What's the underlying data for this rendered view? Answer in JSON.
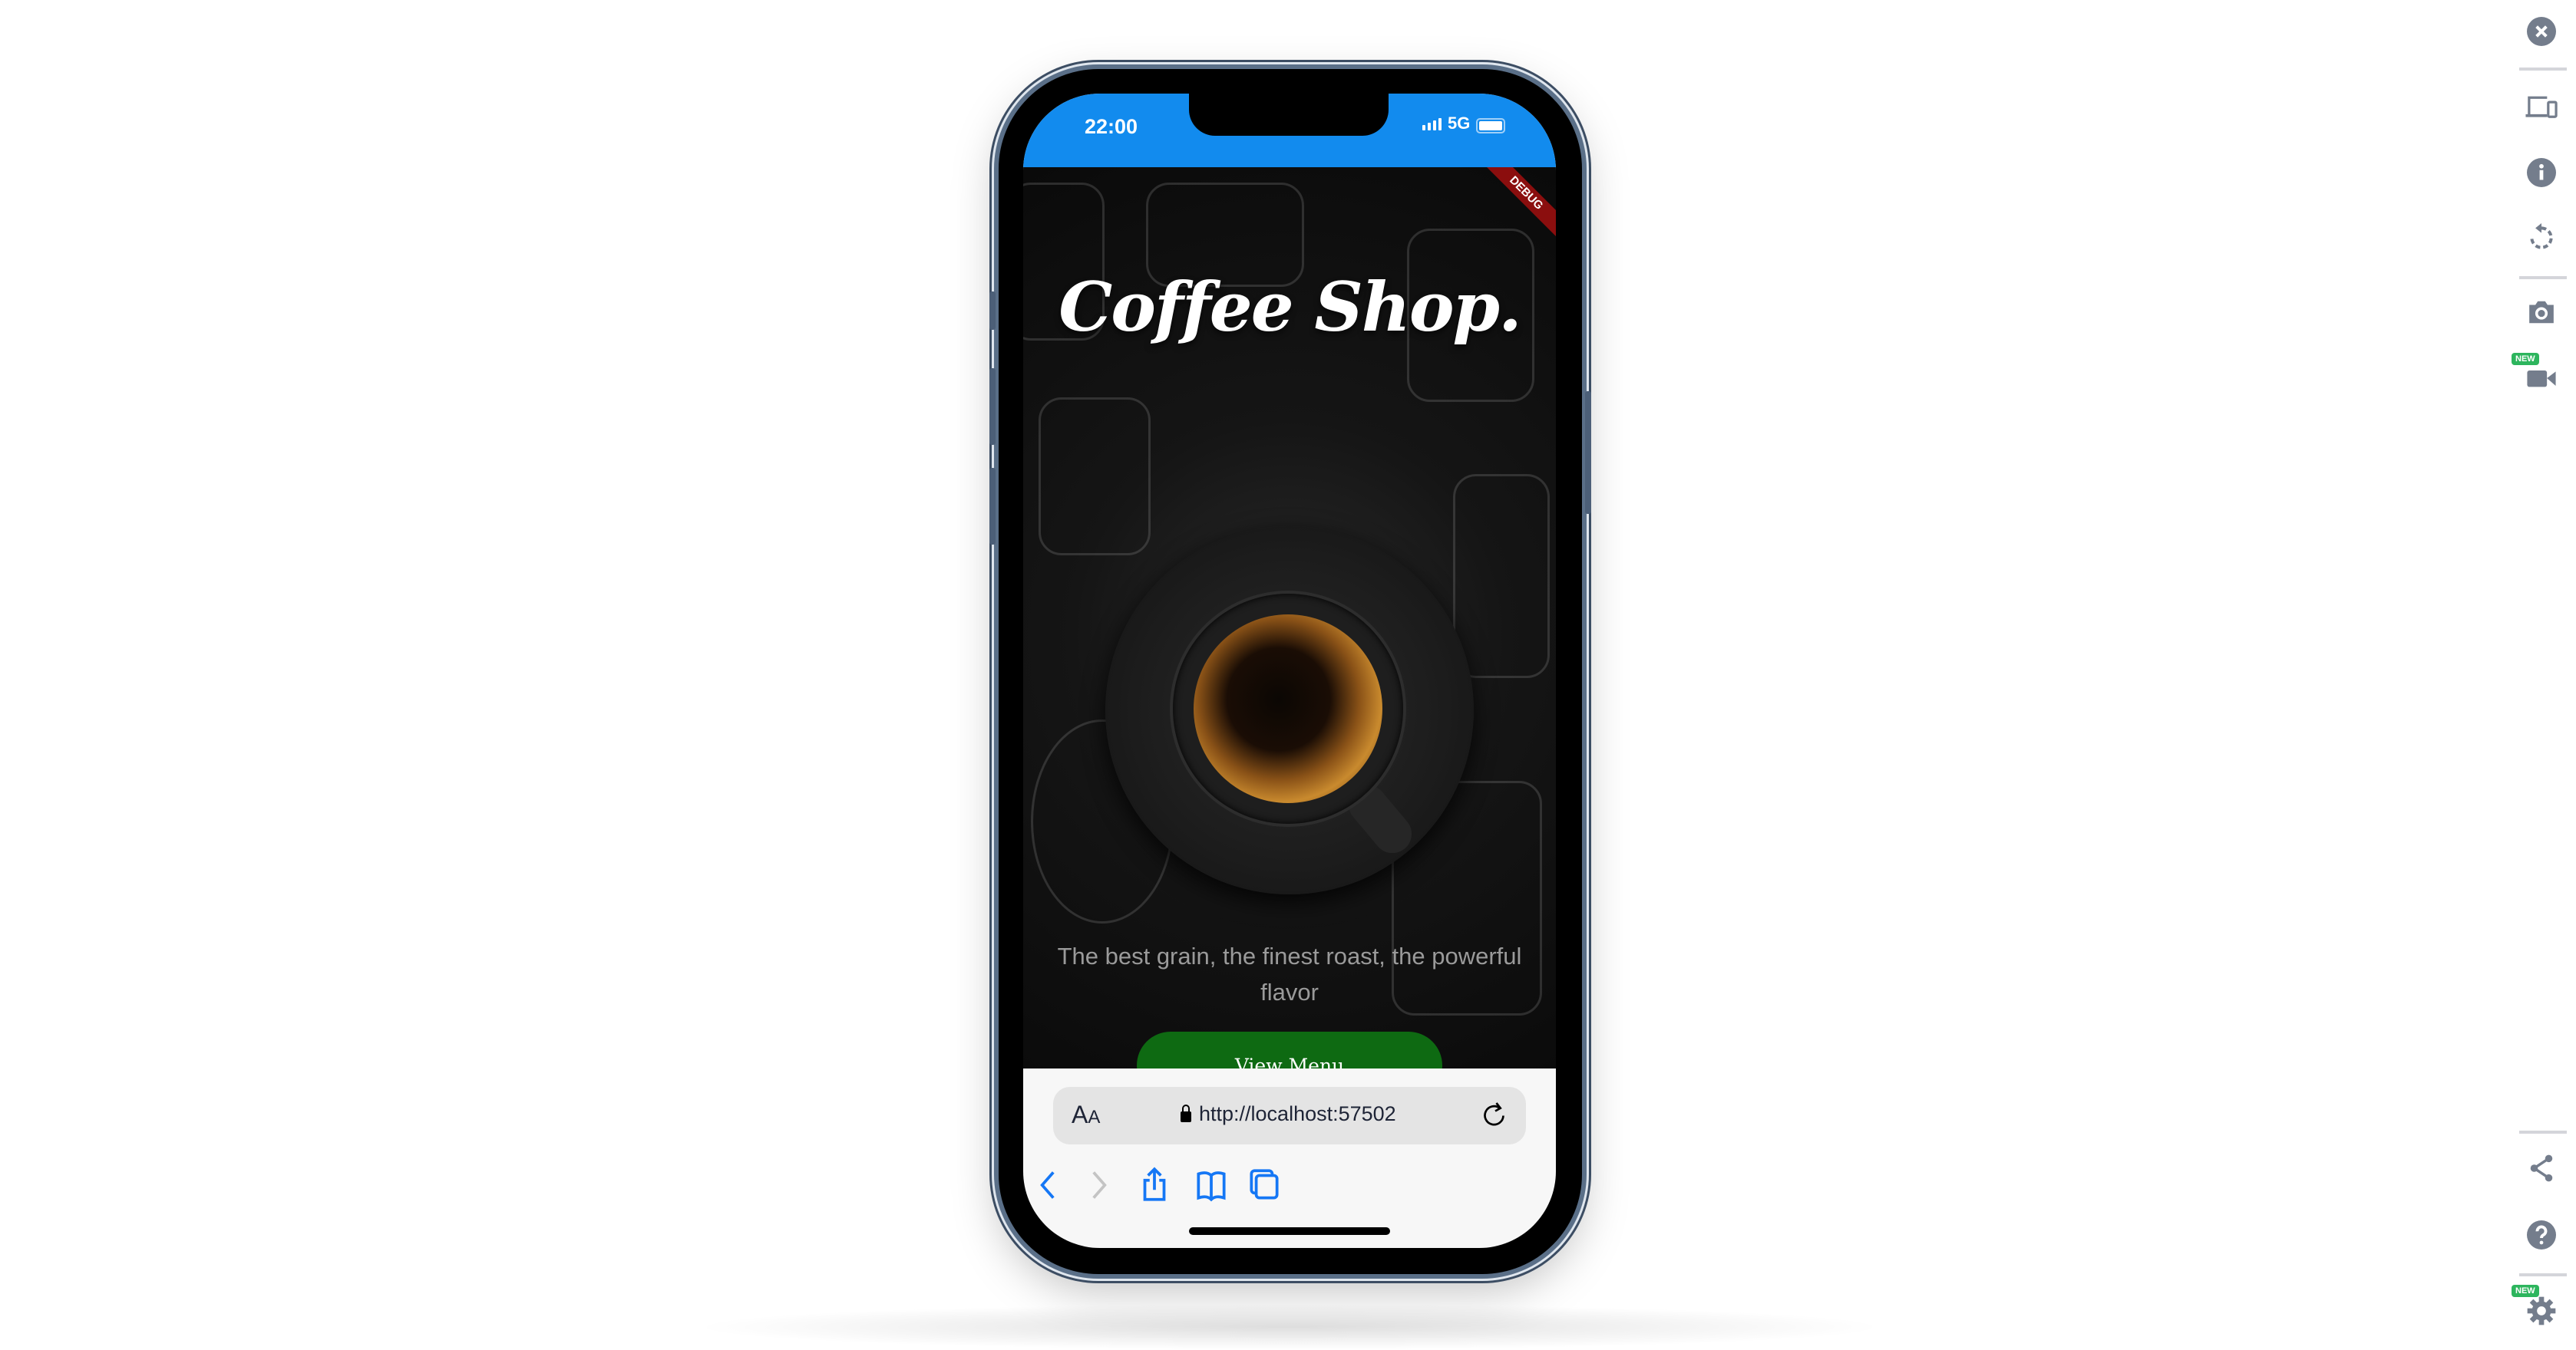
{
  "status_bar": {
    "time": "22:00",
    "network": "5G"
  },
  "app": {
    "debug_banner": "DEBUG",
    "title": "Coffee Shop.",
    "tagline": "The best grain, the finest roast, the powerful flavor",
    "cta_label": "View Menu"
  },
  "browser": {
    "text_size_label_big": "A",
    "text_size_label_small": "A",
    "url": "http://localhost:57502"
  },
  "side_toolbar": {
    "new_badge": "NEW",
    "accent": "#2db55d",
    "icon_color": "#747d8c"
  }
}
